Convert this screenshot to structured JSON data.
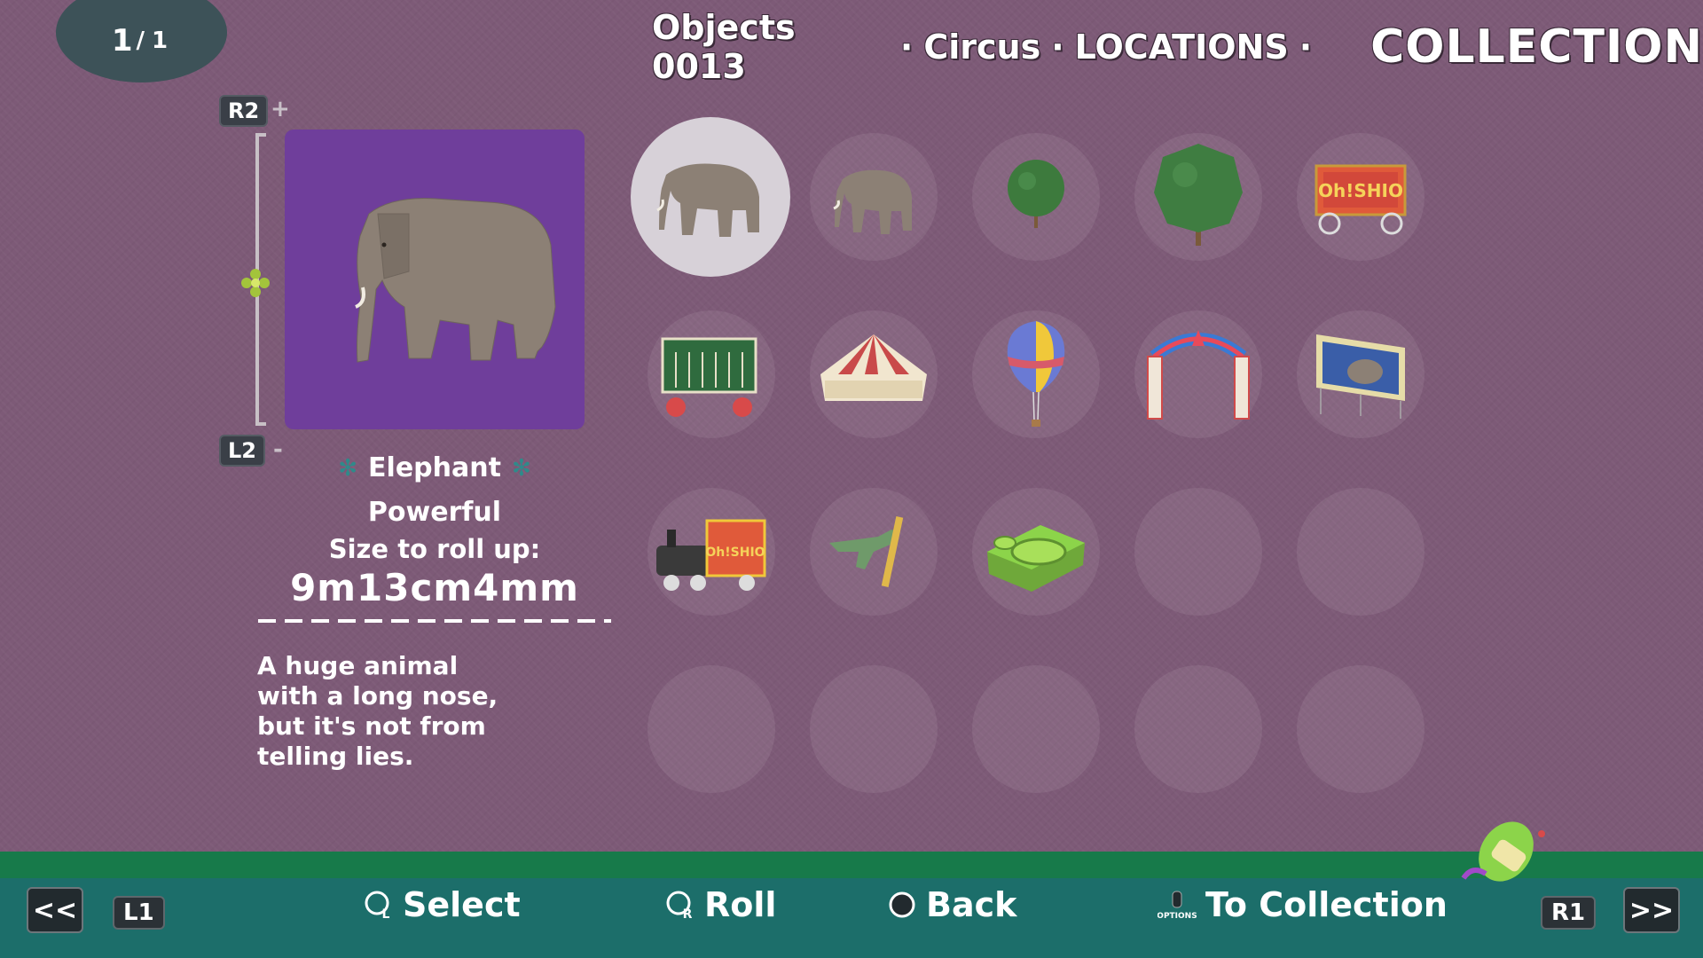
{
  "page": {
    "current": "1",
    "total": "1",
    "sep": "/"
  },
  "header": {
    "category": "Objects 0013",
    "sep1": "·",
    "location": "Circus",
    "sep2": "·",
    "section": "LOCATIONS",
    "sep3": "·",
    "title": "COLLECTION"
  },
  "zoom": {
    "up_button": "R2",
    "up_sign": "+",
    "down_button": "L2",
    "down_sign": "-"
  },
  "selected": {
    "name": "Elephant",
    "trait": "Powerful",
    "size_label": "Size to roll up:",
    "size_value": "9m13cm4mm",
    "description": "A huge animal with a long nose, but it's not from telling lies.",
    "preview_bg": "#6f3e9b"
  },
  "grid": {
    "items": [
      {
        "icon": "elephant-icon",
        "selected": true
      },
      {
        "icon": "elephant-icon"
      },
      {
        "icon": "small-tree-icon"
      },
      {
        "icon": "large-tree-icon"
      },
      {
        "icon": "circus-wagon-icon"
      },
      {
        "icon": "animal-cage-wagon-icon"
      },
      {
        "icon": "circus-tent-icon"
      },
      {
        "icon": "hot-air-balloon-icon"
      },
      {
        "icon": "circus-gate-icon"
      },
      {
        "icon": "billboard-icon"
      },
      {
        "icon": "circus-train-icon"
      },
      {
        "icon": "deer-icon"
      },
      {
        "icon": "playground-mat-icon"
      },
      {
        "icon": "empty"
      },
      {
        "icon": "empty"
      },
      {
        "icon": "empty"
      },
      {
        "icon": "empty"
      },
      {
        "icon": "empty"
      },
      {
        "icon": "empty"
      },
      {
        "icon": "empty"
      }
    ],
    "wagon_label": "Oh!SHIO",
    "train_label": "Oh!SHIO"
  },
  "footer": {
    "prev": "<<",
    "l1": "L1",
    "select": "Select",
    "select_key": "L",
    "roll": "Roll",
    "roll_key": "R",
    "back": "Back",
    "options_key": "OPTIONS",
    "to_collection": "To Collection",
    "r1": "R1",
    "next": ">>"
  },
  "colors": {
    "background": "#7d5a77",
    "bar": "#1c6e6a",
    "bar_top": "#177a4a",
    "accent_teal": "#2f8a8a"
  }
}
